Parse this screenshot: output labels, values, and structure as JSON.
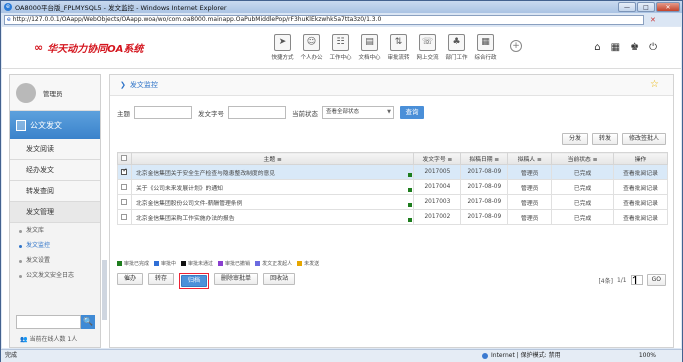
{
  "window": {
    "title": "OA8000平台版_FPLMYSQL5 - 发文监控 - Windows Internet Explorer",
    "min": "—",
    "max": "□",
    "close": "✕"
  },
  "address": {
    "icon": "e",
    "url": "http://127.0.0.1/OAapp/WebObjects/OAapp.woa/wo/com.oa8000.mainapp.OaPubMiddlePop/rF3huKlEkzwhk5a7tta3z0/1.3.0",
    "stop": "✕"
  },
  "header": {
    "logo_mark": "∞",
    "logo_text": "华天动力协同OA系统",
    "tools": [
      {
        "icon": "➤",
        "label": "快捷方式"
      },
      {
        "icon": "☺",
        "label": "个人办公"
      },
      {
        "icon": "☷",
        "label": "工作中心"
      },
      {
        "icon": "▤",
        "label": "文档中心"
      },
      {
        "icon": "⇅",
        "label": "审批流转"
      },
      {
        "icon": "☏",
        "label": "网上交流"
      },
      {
        "icon": "♣",
        "label": "部门工作"
      },
      {
        "icon": "▦",
        "label": "综合行政"
      }
    ],
    "plus": "+",
    "right_icons": [
      "⌂",
      "▦",
      "♚",
      "⏻"
    ]
  },
  "sidebar": {
    "user": "管理员",
    "section": "公文发文",
    "items": [
      "发文阅读",
      "经办发文",
      "转发查阅",
      "发文管理"
    ],
    "subitems": [
      "发文库",
      "发文监控",
      "发文设置",
      "公文发文安全日志"
    ],
    "search_btn": "🔍",
    "online_icon": "👥",
    "online_text": "当前在线人数 1人"
  },
  "main": {
    "breadcrumb": "发文监控",
    "breadcrumb_arrow": "❯",
    "star": "☆",
    "filter": {
      "label_subject": "主题",
      "label_number": "发文字号",
      "label_status": "当前状态",
      "status_value": "查看全部状态",
      "query": "查询"
    },
    "actions": [
      "分发",
      "转发",
      "修改签批人"
    ],
    "columns": [
      "主题",
      "发文字号",
      "拟稿日期",
      "拟稿人",
      "当前状态",
      "操作"
    ],
    "rows": [
      {
        "subject": "北京金信集团关于安全生产检查与隐患整改制度的意见",
        "number": "2017005",
        "date": "2017-08-09",
        "author": "管理员",
        "status": "已完成",
        "op": "查看批阅记录"
      },
      {
        "subject": "关于《公司未来发展计划》的通知",
        "number": "2017004",
        "date": "2017-08-09",
        "author": "管理员",
        "status": "已完成",
        "op": "查看批阅记录"
      },
      {
        "subject": "北京金信集团股份公司文件-薪酬管理条例",
        "number": "2017003",
        "date": "2017-08-09",
        "author": "管理员",
        "status": "已完成",
        "op": "查看批阅记录"
      },
      {
        "subject": "北京金信集团采购工作实施办法的报告",
        "number": "2017002",
        "date": "2017-08-09",
        "author": "管理员",
        "status": "已完成",
        "op": "查看批阅记录"
      }
    ],
    "legend": [
      {
        "label": "审批已完成",
        "color": "#1e7d1e"
      },
      {
        "label": "审批中",
        "color": "#2f6fd6"
      },
      {
        "label": "审批未通过",
        "color": "#111111"
      },
      {
        "label": "审批已撤销",
        "color": "#8a3fcf"
      },
      {
        "label": "发文正发起人",
        "color": "#6b6be0"
      },
      {
        "label": "未发送",
        "color": "#e6a600"
      }
    ],
    "bottom_buttons": [
      "催办",
      "转存",
      "归档",
      "删除审批单",
      "回收站"
    ],
    "pager": {
      "total": "[4条]",
      "page": "1/1",
      "input": "1",
      "go": "GO"
    }
  },
  "status": {
    "left": "完成",
    "zone": "Internet | 保护模式: 禁用",
    "zoom": "100%"
  }
}
